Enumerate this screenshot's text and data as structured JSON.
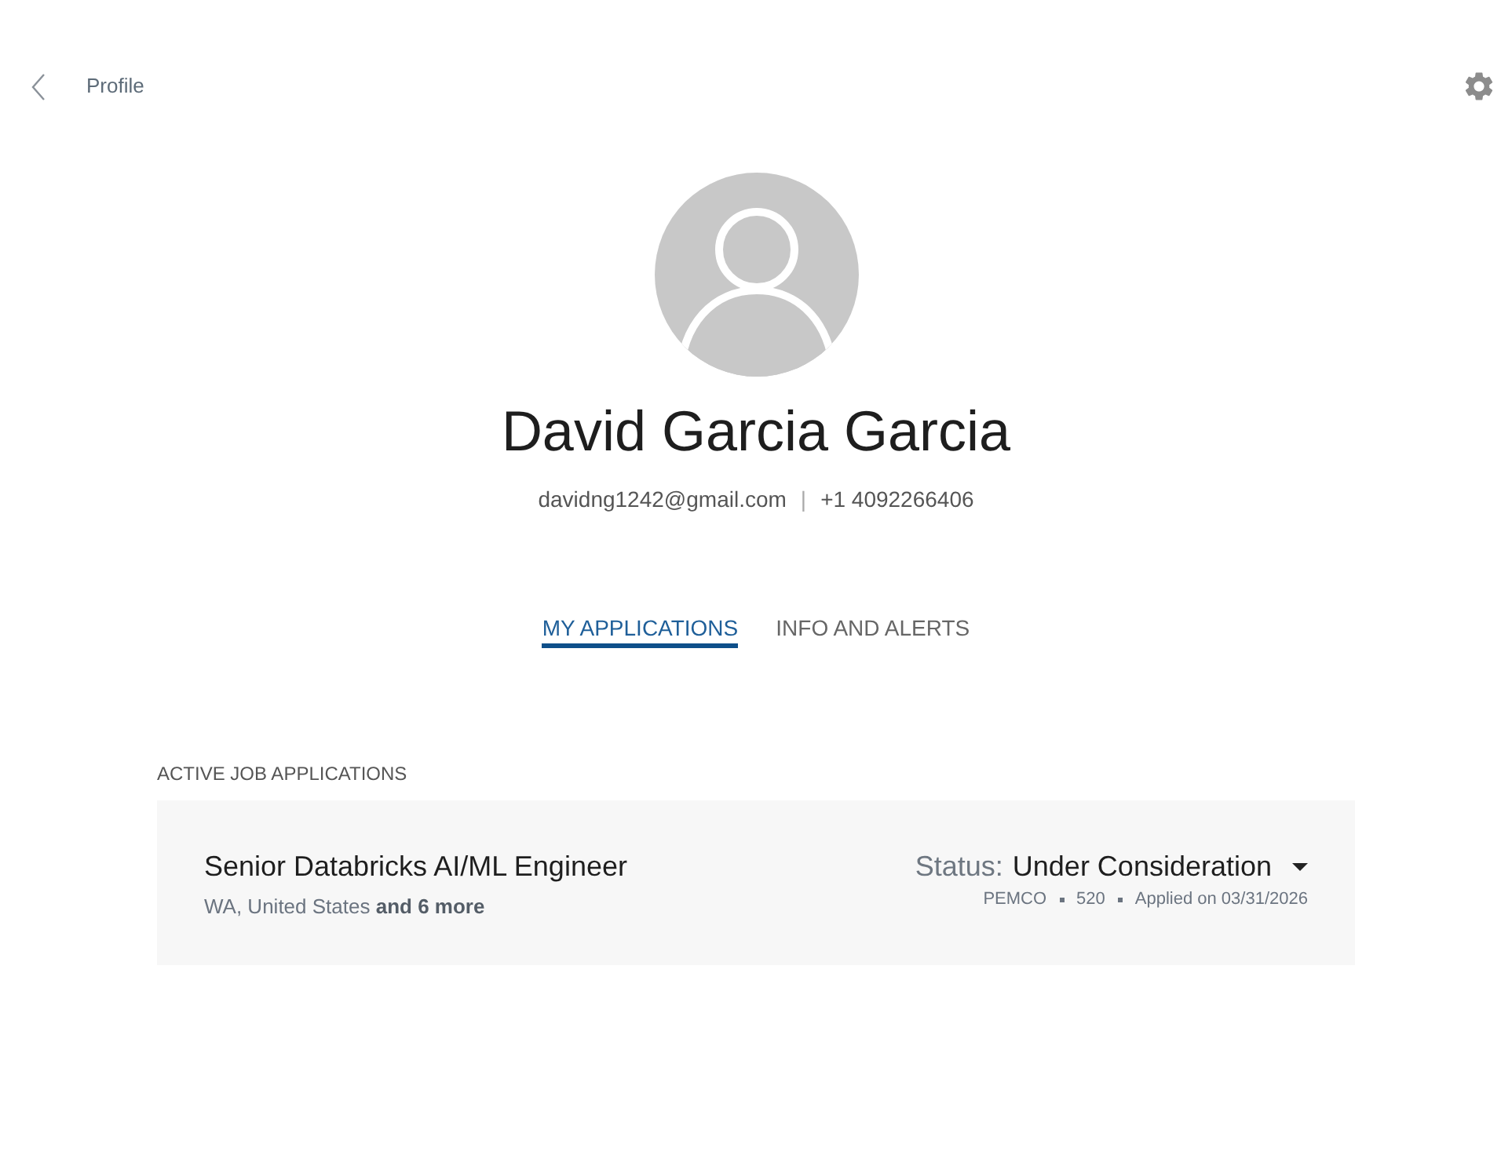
{
  "header": {
    "title": "Profile"
  },
  "profile": {
    "name": "David Garcia Garcia",
    "email": "davidng1242@gmail.com",
    "separator": "|",
    "phone": "+1 4092266406"
  },
  "tabs": [
    {
      "label": "MY APPLICATIONS",
      "selected": true
    },
    {
      "label": "INFO AND ALERTS",
      "selected": false
    }
  ],
  "section": {
    "heading": "ACTIVE JOB APPLICATIONS",
    "applications": [
      {
        "title": "Senior Databricks AI/ML Engineer",
        "location": "WA, United States **and 6 more**",
        "status_label": "Status:",
        "status": "Under Consideration",
        "company": "PEMCO",
        "job_id": "520",
        "applied": "Applied on 03/31/2026"
      }
    ]
  }
}
